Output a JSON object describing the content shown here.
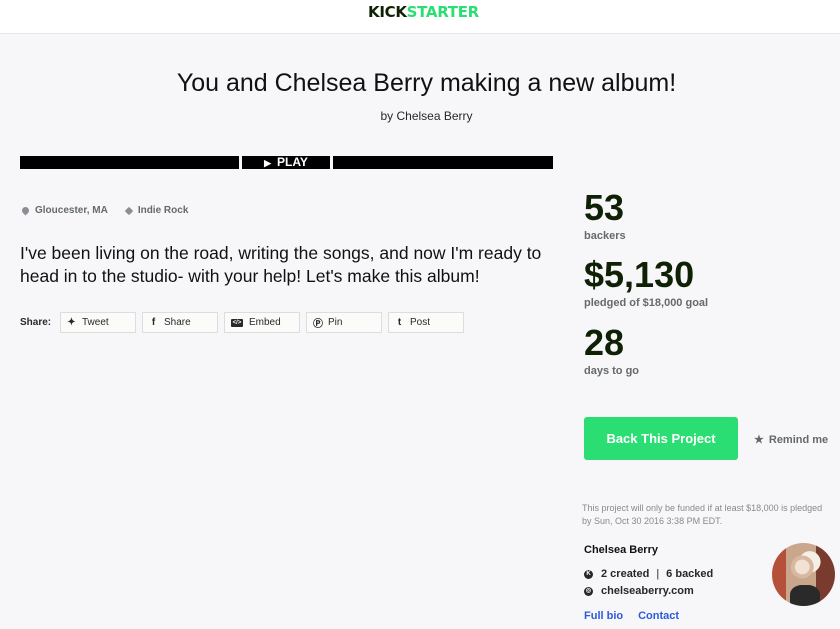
{
  "header": {
    "logo_part1": "KICK",
    "logo_part2": "STARTER"
  },
  "project": {
    "title": "You and Chelsea Berry making a new album!",
    "byline": "by Chelsea Berry",
    "video_play_label": "PLAY",
    "location": "Gloucester, MA",
    "category": "Indie Rock",
    "blurb": "I've been living on the road, writing the songs, and now I'm ready to head in to the studio- with your help! Let's make this album!"
  },
  "share": {
    "label": "Share:",
    "buttons": [
      "Tweet",
      "Share",
      "Embed",
      "Pin",
      "Post"
    ]
  },
  "stats": {
    "backers_count": "53",
    "backers_label": "backers",
    "pledged_amount": "$5,130",
    "pledged_label": "pledged of $18,000 goal",
    "days_count": "28",
    "days_label": "days to go"
  },
  "actions": {
    "back_label": "Back This Project",
    "remind_label": "Remind me"
  },
  "funding_note": "This project will only be funded if at least $18,000 is pledged by Sun, Oct 30 2016 3:38 PM EDT.",
  "creator": {
    "name": "Chelsea Berry",
    "created": "2 created",
    "backed": "6 backed",
    "website": "chelseaberry.com",
    "full_bio_label": "Full bio",
    "contact_label": "Contact"
  },
  "colors": {
    "brand_green": "#2bde73",
    "link_blue": "#2e59d9",
    "dark_text": "#0f2105"
  }
}
